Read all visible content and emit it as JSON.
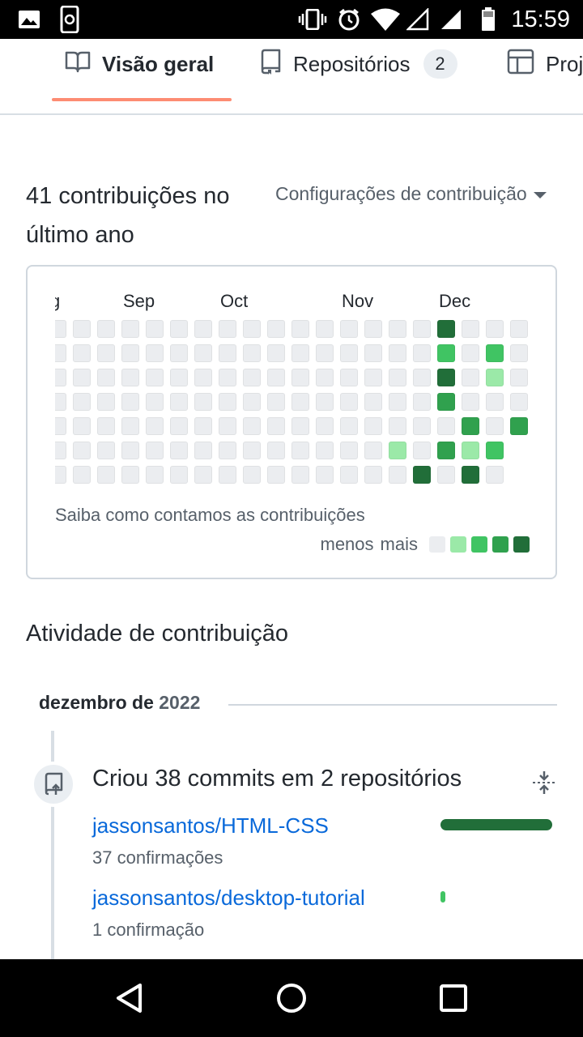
{
  "status_bar": {
    "time": "15:59",
    "icons": [
      "image-icon",
      "phone-sync-icon",
      "vibrate-icon",
      "alarm-icon",
      "wifi-icon",
      "signal-empty-icon",
      "signal-icon",
      "battery-icon"
    ]
  },
  "tabs": [
    {
      "label": "Visão geral",
      "icon": "book-icon",
      "selected": true
    },
    {
      "label": "Repositórios",
      "icon": "repo-icon",
      "count": "2"
    },
    {
      "label": "Proj",
      "icon": "table-icon"
    }
  ],
  "contributions": {
    "title": "41 contribuições no último ano",
    "settings_label": "Configurações de contribuição",
    "months": [
      {
        "label": "g",
        "col": 0
      },
      {
        "label": "Sep",
        "col": 3
      },
      {
        "label": "Oct",
        "col": 7
      },
      {
        "label": "Nov",
        "col": 12
      },
      {
        "label": "Dec",
        "col": 16
      }
    ],
    "weeks": [
      [
        0,
        0,
        0,
        0,
        0,
        0,
        0
      ],
      [
        0,
        0,
        0,
        0,
        0,
        0,
        0
      ],
      [
        0,
        0,
        0,
        0,
        0,
        0,
        0
      ],
      [
        0,
        0,
        0,
        0,
        0,
        0,
        0
      ],
      [
        0,
        0,
        0,
        0,
        0,
        0,
        0
      ],
      [
        0,
        0,
        0,
        0,
        0,
        0,
        0
      ],
      [
        0,
        0,
        0,
        0,
        0,
        0,
        0
      ],
      [
        0,
        0,
        0,
        0,
        0,
        0,
        0
      ],
      [
        0,
        0,
        0,
        0,
        0,
        0,
        0
      ],
      [
        0,
        0,
        0,
        0,
        0,
        0,
        0
      ],
      [
        0,
        0,
        0,
        0,
        0,
        0,
        0
      ],
      [
        0,
        0,
        0,
        0,
        0,
        0,
        0
      ],
      [
        0,
        0,
        0,
        0,
        0,
        0,
        0
      ],
      [
        0,
        0,
        0,
        0,
        0,
        0,
        0
      ],
      [
        0,
        0,
        0,
        0,
        0,
        1,
        0
      ],
      [
        0,
        0,
        0,
        0,
        0,
        0,
        4
      ],
      [
        4,
        2,
        4,
        3,
        0,
        3,
        0
      ],
      [
        0,
        0,
        0,
        0,
        3,
        1,
        4
      ],
      [
        0,
        2,
        1,
        0,
        0,
        2,
        0
      ],
      [
        0,
        0,
        0,
        0,
        3,
        null,
        null
      ]
    ],
    "learn_label": "Saiba como contamos as contribuições",
    "legend_less": "menos",
    "legend_more": "mais",
    "level_colors": [
      "#ebedf0",
      "#9be9a8",
      "#40c463",
      "#30a14e",
      "#216e39"
    ]
  },
  "activity": {
    "title": "Atividade de contribuição",
    "month": "dezembro de",
    "year": "2022",
    "event_title": "Criou 38 commits em 2 repositórios",
    "repos": [
      {
        "name": "jassonsantos/HTML-CSS",
        "count_label": "37 confirmações",
        "share": 0.974
      },
      {
        "name": "jassonsantos/desktop-tutorial",
        "count_label": "1 confirmação",
        "share": 0.026
      }
    ]
  },
  "nav_bar": {
    "icons": [
      "back-icon",
      "home-icon",
      "recents-icon"
    ]
  }
}
